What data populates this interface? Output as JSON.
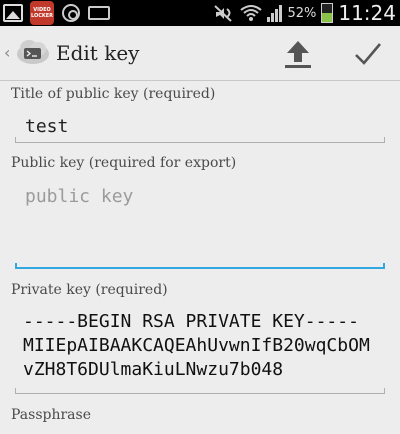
{
  "status_bar": {
    "app_badge": "VIDEO LOCKER",
    "battery_percent": "52%",
    "battery_level": 0.52,
    "time": "11:24"
  },
  "action_bar": {
    "back_glyph": "‹",
    "title": "Edit key",
    "export_icon": "upload-icon",
    "done_icon": "checkmark-icon"
  },
  "form": {
    "title_label": "Title of public key (required)",
    "title_value": "test",
    "public_key_label": "Public key (required for export)",
    "public_key_placeholder": "public key",
    "private_key_label": "Private key (required)",
    "private_key_value": "-----BEGIN RSA PRIVATE KEY-----\nMIIEpAIBAAKCAQEAhUvwnIfB20wqCbOMvZH8T6DUlmaKiuLNwzu7b048",
    "passphrase_label": "Passphrase"
  }
}
